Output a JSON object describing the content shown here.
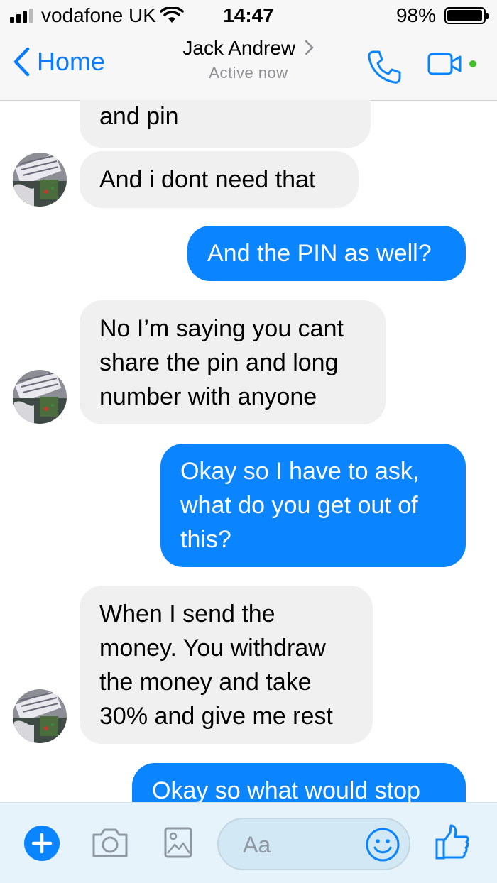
{
  "status_bar": {
    "carrier": "vodafone UK",
    "time": "14:47",
    "battery": "98%"
  },
  "header": {
    "back_label": "Home",
    "contact_name": "Jack Andrew",
    "status": "Active now",
    "icons": [
      "chevron-left-icon",
      "chevron-right-icon",
      "phone-icon",
      "video-camera-icon"
    ]
  },
  "messages": [
    {
      "from": "them",
      "text": "and pin"
    },
    {
      "from": "them",
      "text": "And i dont need that"
    },
    {
      "from": "me",
      "text": "And the PIN as well?"
    },
    {
      "from": "them",
      "lines": [
        "No I’m saying you cant",
        "share the pin and long",
        "number with anyone"
      ]
    },
    {
      "from": "me",
      "lines": [
        "Okay so I have to ask,",
        "what do you get out of",
        "this?"
      ]
    },
    {
      "from": "them",
      "lines": [
        "When I send the",
        "money. You withdraw",
        "the money and take",
        "30% and give me rest"
      ]
    },
    {
      "from": "me",
      "text": "Okay so what would stop"
    }
  ],
  "composer": {
    "placeholder": "Aa",
    "icons": [
      "plus-icon",
      "camera-icon",
      "image-icon",
      "smiley-icon",
      "thumbs-up-icon"
    ]
  },
  "colors": {
    "accent": "#0a84ff",
    "incoming_bubble": "#f0f0f0",
    "online_dot": "#44c02a"
  }
}
